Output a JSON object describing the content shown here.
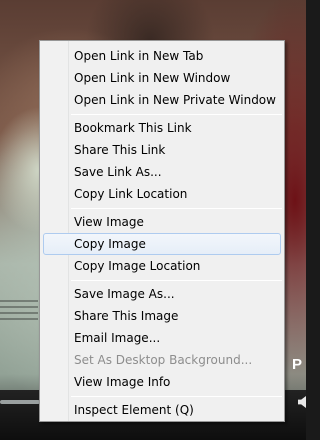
{
  "background": {
    "description_icon": "video-frame",
    "overlay_letter": "P"
  },
  "context_menu": {
    "groups": [
      [
        {
          "label": "Open Link in New Tab",
          "enabled": true
        },
        {
          "label": "Open Link in New Window",
          "enabled": true
        },
        {
          "label": "Open Link in New Private Window",
          "enabled": true
        }
      ],
      [
        {
          "label": "Bookmark This Link",
          "enabled": true
        },
        {
          "label": "Share This Link",
          "enabled": true
        },
        {
          "label": "Save Link As...",
          "enabled": true
        },
        {
          "label": "Copy Link Location",
          "enabled": true
        }
      ],
      [
        {
          "label": "View Image",
          "enabled": true
        },
        {
          "label": "Copy Image",
          "enabled": true,
          "highlighted": true
        },
        {
          "label": "Copy Image Location",
          "enabled": true
        }
      ],
      [
        {
          "label": "Save Image As...",
          "enabled": true
        },
        {
          "label": "Share This Image",
          "enabled": true
        },
        {
          "label": "Email Image...",
          "enabled": true
        },
        {
          "label": "Set As Desktop Background...",
          "enabled": false
        },
        {
          "label": "View Image Info",
          "enabled": true
        }
      ],
      [
        {
          "label": "Inspect Element (Q)",
          "enabled": true
        }
      ]
    ]
  },
  "colors": {
    "menu_bg": "#f0f0f0",
    "highlight_border": "#aecbef",
    "disabled_text": "#8d8d8d"
  }
}
